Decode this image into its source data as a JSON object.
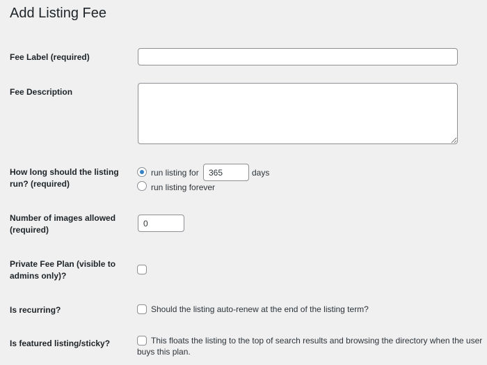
{
  "page": {
    "title": "Add Listing Fee"
  },
  "fields": {
    "fee_label": {
      "label": "Fee Label (required)",
      "value": ""
    },
    "fee_description": {
      "label": "Fee Description",
      "value": ""
    },
    "duration": {
      "label_line1": "How long should the listing",
      "label_line2": "run? (required)",
      "option_days_prefix": "run listing for",
      "days_value": "365",
      "days_suffix": "days",
      "option_forever": "run listing forever",
      "selected": "days"
    },
    "images": {
      "label_line1": "Number of images allowed",
      "label_line2": "(required)",
      "value": "0"
    },
    "private": {
      "label_line1": "Private Fee Plan (visible to",
      "label_line2": "admins only)?",
      "checked": false
    },
    "recurring": {
      "label": "Is recurring?",
      "description": "Should the listing auto-renew at the end of the listing term?",
      "checked": false
    },
    "featured": {
      "label": "Is featured listing/sticky?",
      "description_line1": "This floats the listing to the top of search results and browsing the directory when the user",
      "description_line2": "buys this plan.",
      "checked": false
    }
  }
}
